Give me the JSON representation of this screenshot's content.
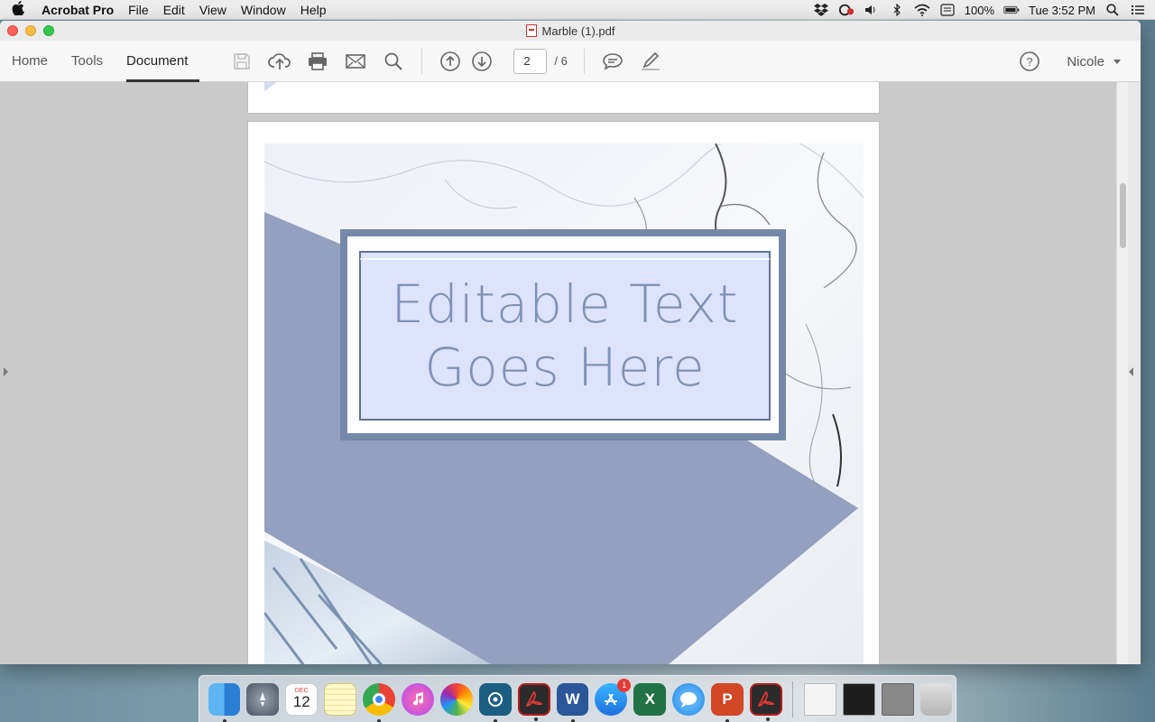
{
  "menubar": {
    "app_name": "Acrobat Pro",
    "items": [
      "File",
      "Edit",
      "View",
      "Window",
      "Help"
    ],
    "battery": "100%",
    "clock": "Tue 3:52 PM"
  },
  "window": {
    "title": "Marble (1).pdf"
  },
  "toolbar": {
    "tabs": [
      "Home",
      "Tools",
      "Document"
    ],
    "page_current": "2",
    "page_total": "/ 6",
    "user": "Nicole"
  },
  "document": {
    "text_line1": "Editable Text",
    "text_line2": "Goes Here"
  },
  "dock": {
    "calendar_month": "DEC",
    "calendar_day": "12",
    "app_store_badge": "1"
  },
  "colors": {
    "accent_slate": "#93a0bf",
    "frame_blue": "#7489a9",
    "field_fill": "#dde3fb",
    "text_color": "#7f92b6"
  }
}
